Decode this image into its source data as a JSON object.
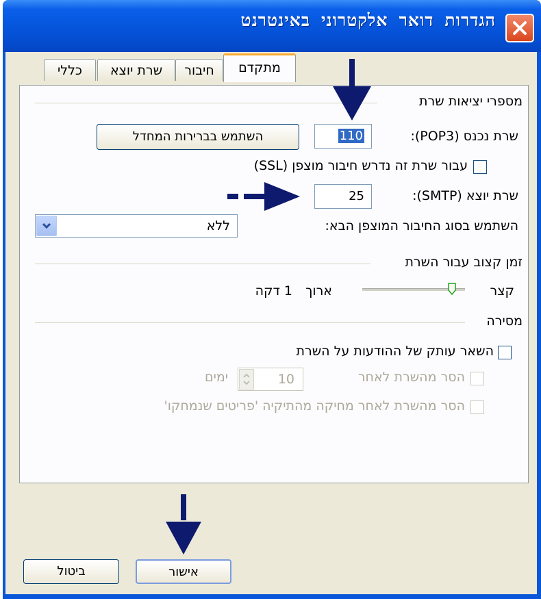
{
  "window": {
    "title": "הגדרות דואר אלקטרוני באינטרנט"
  },
  "tabs": [
    {
      "label": "מתקדם",
      "active": true
    },
    {
      "label": "חיבור",
      "active": false
    },
    {
      "label": "שרת יוצא",
      "active": false
    },
    {
      "label": "כללי",
      "active": false
    }
  ],
  "ports_group": {
    "title": "מספרי יציאות שרת",
    "incoming_label": "שרת נכנס (POP3):",
    "incoming_value": "110",
    "defaults_button": "השתמש בברירות המחדל",
    "ssl_label": "עבור שרת זה נדרש חיבור מוצפן (SSL)",
    "outgoing_label": "שרת יוצא (SMTP):",
    "outgoing_value": "25",
    "encryption_label": "השתמש בסוג החיבור המוצפן הבא:",
    "encryption_value": "ללא"
  },
  "timeout_group": {
    "title": "זמן קצוב עבור השרת",
    "short_label": "קצר",
    "long_label": "ארוך",
    "value_label": "1 דקה",
    "level": 0.05
  },
  "delivery_group": {
    "title": "מסירה",
    "leave_copy_label": "השאר עותק של ההודעות על השרת",
    "remove_after_label": "הסר מהשרת לאחר",
    "days_value": "10",
    "days_label": "ימים",
    "remove_deleted_label": "הסר מהשרת לאחר מחיקה מהתיקיה 'פריטים שנמחקו'"
  },
  "footer": {
    "ok_label": "אישור",
    "cancel_label": "ביטול"
  },
  "colors": {
    "arrow": "#0d1a6e",
    "titlebar": "#0553d9",
    "tab_highlight": "#f5ac31"
  }
}
